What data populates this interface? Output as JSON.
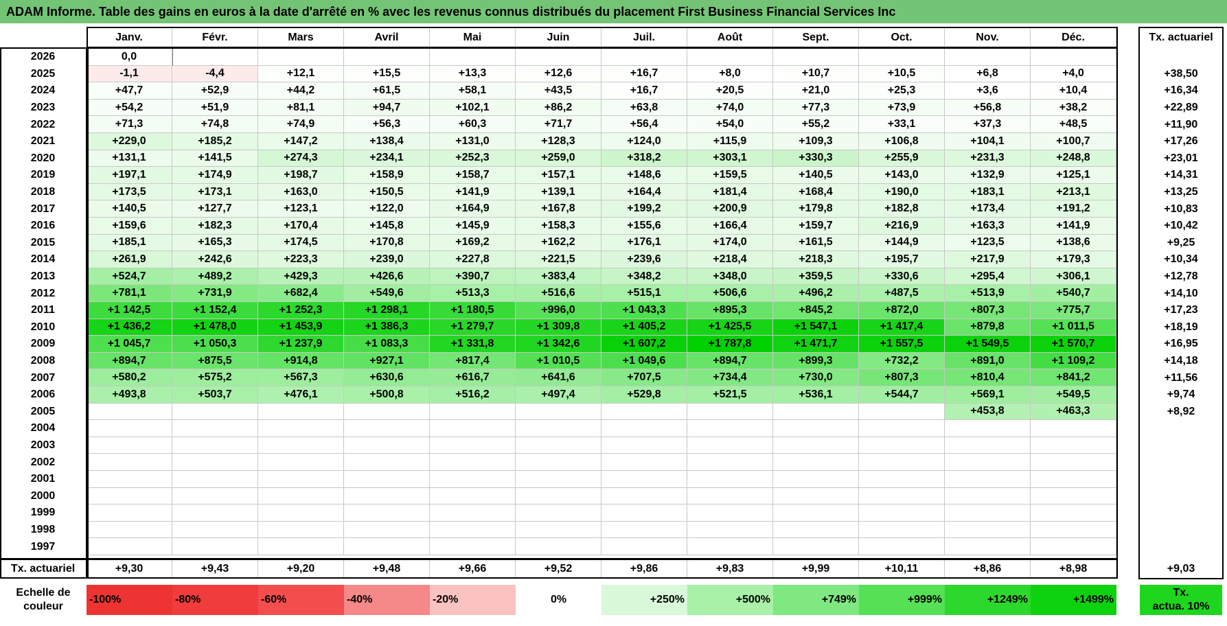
{
  "title": "ADAM Informe. Table des gains en euros à la date d'arrêté en % avec les revenus connus distribués du placement First Business Financial Services Inc",
  "table": {
    "months": [
      "Janv.",
      "Févr.",
      "Mars",
      "Avril",
      "Mai",
      "Juin",
      "Juil.",
      "Août",
      "Sept.",
      "Oct.",
      "Nov.",
      "Déc."
    ],
    "annual_header": "Tx. actuariel",
    "rows": [
      {
        "year": "2026",
        "cells": [
          "0,0",
          "",
          "",
          "",
          "",
          "",
          "",
          "",
          "",
          "",
          "",
          ""
        ],
        "annual": ""
      },
      {
        "year": "2025",
        "cells": [
          "-1,1",
          "-4,4",
          "+12,1",
          "+15,5",
          "+13,3",
          "+12,6",
          "+16,7",
          "+8,0",
          "+10,7",
          "+10,5",
          "+6,8",
          "+4,0"
        ],
        "annual": "+38,50"
      },
      {
        "year": "2024",
        "cells": [
          "+47,7",
          "+52,9",
          "+44,2",
          "+61,5",
          "+58,1",
          "+43,5",
          "+16,7",
          "+20,5",
          "+21,0",
          "+25,3",
          "+3,6",
          "+10,4"
        ],
        "annual": "+16,34"
      },
      {
        "year": "2023",
        "cells": [
          "+54,2",
          "+51,9",
          "+81,1",
          "+94,7",
          "+102,1",
          "+86,2",
          "+63,8",
          "+74,0",
          "+77,3",
          "+73,9",
          "+56,8",
          "+38,2"
        ],
        "annual": "+22,89"
      },
      {
        "year": "2022",
        "cells": [
          "+71,3",
          "+74,8",
          "+74,9",
          "+56,3",
          "+60,3",
          "+71,7",
          "+56,4",
          "+54,0",
          "+55,2",
          "+33,1",
          "+37,3",
          "+48,5"
        ],
        "annual": "+11,90"
      },
      {
        "year": "2021",
        "cells": [
          "+229,0",
          "+185,2",
          "+147,2",
          "+138,4",
          "+131,0",
          "+128,3",
          "+124,0",
          "+115,9",
          "+109,3",
          "+106,8",
          "+104,1",
          "+100,7"
        ],
        "annual": "+17,26"
      },
      {
        "year": "2020",
        "cells": [
          "+131,1",
          "+141,5",
          "+274,3",
          "+234,1",
          "+252,3",
          "+259,0",
          "+318,2",
          "+303,1",
          "+330,3",
          "+255,9",
          "+231,3",
          "+248,8"
        ],
        "annual": "+23,01"
      },
      {
        "year": "2019",
        "cells": [
          "+197,1",
          "+174,9",
          "+198,7",
          "+158,9",
          "+158,7",
          "+157,1",
          "+148,6",
          "+159,5",
          "+140,5",
          "+143,0",
          "+132,9",
          "+125,1"
        ],
        "annual": "+14,31"
      },
      {
        "year": "2018",
        "cells": [
          "+173,5",
          "+173,1",
          "+163,0",
          "+150,5",
          "+141,9",
          "+139,1",
          "+164,4",
          "+181,4",
          "+168,4",
          "+190,0",
          "+183,1",
          "+213,1"
        ],
        "annual": "+13,25"
      },
      {
        "year": "2017",
        "cells": [
          "+140,5",
          "+127,7",
          "+123,1",
          "+122,0",
          "+164,9",
          "+167,8",
          "+199,2",
          "+200,9",
          "+179,8",
          "+182,8",
          "+173,4",
          "+191,2"
        ],
        "annual": "+10,83"
      },
      {
        "year": "2016",
        "cells": [
          "+159,6",
          "+182,3",
          "+170,4",
          "+145,8",
          "+145,9",
          "+158,3",
          "+155,6",
          "+166,4",
          "+159,7",
          "+216,9",
          "+163,3",
          "+141,9"
        ],
        "annual": "+10,42"
      },
      {
        "year": "2015",
        "cells": [
          "+185,1",
          "+165,3",
          "+174,5",
          "+170,8",
          "+169,2",
          "+162,2",
          "+176,1",
          "+174,0",
          "+161,5",
          "+144,9",
          "+123,5",
          "+138,6"
        ],
        "annual": "+9,25"
      },
      {
        "year": "2014",
        "cells": [
          "+261,9",
          "+242,6",
          "+223,3",
          "+239,0",
          "+227,8",
          "+221,5",
          "+239,6",
          "+218,4",
          "+218,3",
          "+195,7",
          "+217,9",
          "+179,3"
        ],
        "annual": "+10,34"
      },
      {
        "year": "2013",
        "cells": [
          "+524,7",
          "+489,2",
          "+429,3",
          "+426,6",
          "+390,7",
          "+383,4",
          "+348,2",
          "+348,0",
          "+359,5",
          "+330,6",
          "+295,4",
          "+306,1"
        ],
        "annual": "+12,78"
      },
      {
        "year": "2012",
        "cells": [
          "+781,1",
          "+731,9",
          "+682,4",
          "+549,6",
          "+513,3",
          "+516,6",
          "+515,1",
          "+506,6",
          "+496,2",
          "+487,5",
          "+513,9",
          "+540,7"
        ],
        "annual": "+14,10"
      },
      {
        "year": "2011",
        "cells": [
          "+1 142,5",
          "+1 152,4",
          "+1 252,3",
          "+1 298,1",
          "+1 180,5",
          "+996,0",
          "+1 043,3",
          "+895,3",
          "+845,2",
          "+872,0",
          "+807,3",
          "+775,7"
        ],
        "annual": "+17,23"
      },
      {
        "year": "2010",
        "cells": [
          "+1 436,2",
          "+1 478,0",
          "+1 453,9",
          "+1 386,3",
          "+1 279,7",
          "+1 309,8",
          "+1 405,2",
          "+1 425,5",
          "+1 547,1",
          "+1 417,4",
          "+879,8",
          "+1 011,5"
        ],
        "annual": "+18,19"
      },
      {
        "year": "2009",
        "cells": [
          "+1 045,7",
          "+1 050,3",
          "+1 237,9",
          "+1 083,3",
          "+1 331,8",
          "+1 342,6",
          "+1 607,2",
          "+1 787,8",
          "+1 471,7",
          "+1 557,5",
          "+1 549,5",
          "+1 570,7"
        ],
        "annual": "+16,95"
      },
      {
        "year": "2008",
        "cells": [
          "+894,7",
          "+875,5",
          "+914,8",
          "+927,1",
          "+817,4",
          "+1 010,5",
          "+1 049,6",
          "+894,7",
          "+899,3",
          "+732,2",
          "+891,0",
          "+1 109,2"
        ],
        "annual": "+14,18"
      },
      {
        "year": "2007",
        "cells": [
          "+580,2",
          "+575,2",
          "+567,3",
          "+630,6",
          "+616,7",
          "+641,6",
          "+707,5",
          "+734,4",
          "+730,0",
          "+807,3",
          "+810,4",
          "+841,2"
        ],
        "annual": "+11,56"
      },
      {
        "year": "2006",
        "cells": [
          "+493,8",
          "+503,7",
          "+476,1",
          "+500,8",
          "+516,2",
          "+497,4",
          "+529,8",
          "+521,5",
          "+536,1",
          "+544,7",
          "+569,1",
          "+549,5"
        ],
        "annual": "+9,74"
      },
      {
        "year": "2005",
        "cells": [
          "",
          "",
          "",
          "",
          "",
          "",
          "",
          "",
          "",
          "",
          "+453,8",
          "+463,3"
        ],
        "annual": "+8,92"
      },
      {
        "year": "2004",
        "cells": [
          "",
          "",
          "",
          "",
          "",
          "",
          "",
          "",
          "",
          "",
          "",
          ""
        ],
        "annual": ""
      },
      {
        "year": "2003",
        "cells": [
          "",
          "",
          "",
          "",
          "",
          "",
          "",
          "",
          "",
          "",
          "",
          ""
        ],
        "annual": ""
      },
      {
        "year": "2002",
        "cells": [
          "",
          "",
          "",
          "",
          "",
          "",
          "",
          "",
          "",
          "",
          "",
          ""
        ],
        "annual": ""
      },
      {
        "year": "2001",
        "cells": [
          "",
          "",
          "",
          "",
          "",
          "",
          "",
          "",
          "",
          "",
          "",
          ""
        ],
        "annual": ""
      },
      {
        "year": "2000",
        "cells": [
          "",
          "",
          "",
          "",
          "",
          "",
          "",
          "",
          "",
          "",
          "",
          ""
        ],
        "annual": ""
      },
      {
        "year": "1999",
        "cells": [
          "",
          "",
          "",
          "",
          "",
          "",
          "",
          "",
          "",
          "",
          "",
          ""
        ],
        "annual": ""
      },
      {
        "year": "1998",
        "cells": [
          "",
          "",
          "",
          "",
          "",
          "",
          "",
          "",
          "",
          "",
          "",
          ""
        ],
        "annual": ""
      },
      {
        "year": "1997",
        "cells": [
          "",
          "",
          "",
          "",
          "",
          "",
          "",
          "",
          "",
          "",
          "",
          ""
        ],
        "annual": ""
      }
    ],
    "footer": {
      "label": "Tx. actuariel",
      "cells": [
        "+9,30",
        "+9,43",
        "+9,20",
        "+9,48",
        "+9,66",
        "+9,52",
        "+9,86",
        "+9,83",
        "+9,99",
        "+10,11",
        "+8,86",
        "+8,98"
      ],
      "annual": "+9,03"
    }
  },
  "legend": {
    "label_line1": "Echelle de",
    "label_line2": "couleur",
    "steps": [
      {
        "label": "-100%",
        "color": "#ee3333",
        "align": "left"
      },
      {
        "label": "-80%",
        "color": "#f03c3c",
        "align": "left"
      },
      {
        "label": "-60%",
        "color": "#f24e4e",
        "align": "left"
      },
      {
        "label": "-40%",
        "color": "#f58888",
        "align": "left"
      },
      {
        "label": "-20%",
        "color": "#fbc2c2",
        "align": "left"
      },
      {
        "label": "0%",
        "color": "#ffffff",
        "align": "center"
      },
      {
        "label": "+250%",
        "color": "#daf8da",
        "align": "right"
      },
      {
        "label": "+500%",
        "color": "#a9f0a9",
        "align": "right"
      },
      {
        "label": "+749%",
        "color": "#80e880",
        "align": "right"
      },
      {
        "label": "+999%",
        "color": "#55e055",
        "align": "right"
      },
      {
        "label": "+1249%",
        "color": "#2cd82c",
        "align": "right"
      },
      {
        "label": "+1499%",
        "color": "#0ed20e",
        "align": "right"
      }
    ],
    "annual_label_line1": "Tx.",
    "annual_label_line2": "actua. 10%",
    "annual_color": "#1ed61e"
  }
}
